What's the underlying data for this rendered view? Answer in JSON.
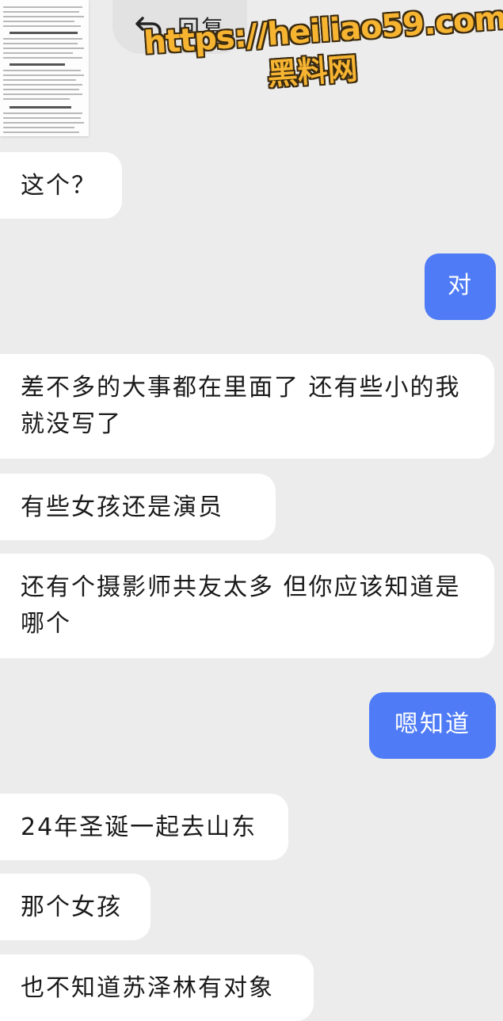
{
  "reply_bar": {
    "icon": "reply-arrow-icon",
    "label": "回复"
  },
  "watermark": {
    "url": "https://heiliao59.com",
    "site_name": "黑料网",
    "color": "#f6b431"
  },
  "colors": {
    "background": "#ececec",
    "incoming_bubble": "#ffffff",
    "outgoing_bubble": "#4f7cf6"
  },
  "messages": [
    {
      "direction": "in",
      "text": "这个？"
    },
    {
      "direction": "out",
      "text": "对"
    },
    {
      "direction": "in",
      "text": "差不多的大事都在里面了  还有些小的我就没写了"
    },
    {
      "direction": "in",
      "text": "有些女孩还是演员"
    },
    {
      "direction": "in",
      "text": "还有个摄影师共友太多  但你应该知道是哪个"
    },
    {
      "direction": "out",
      "text": "嗯知道"
    },
    {
      "direction": "in",
      "text": "24年圣诞一起去山东"
    },
    {
      "direction": "in",
      "text": "那个女孩"
    },
    {
      "direction": "in",
      "text": "也不知道苏泽林有对象"
    }
  ]
}
